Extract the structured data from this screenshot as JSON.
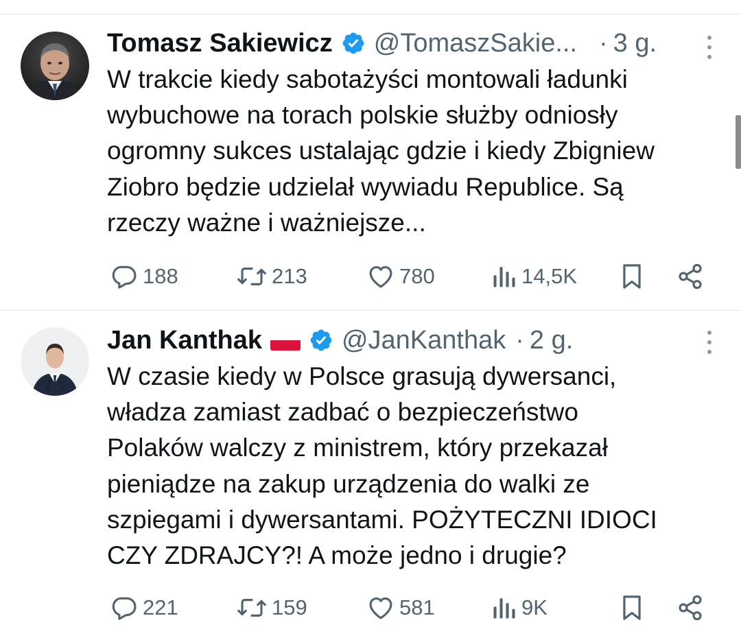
{
  "tweets": [
    {
      "display_name": "Tomasz Sakiewicz",
      "verified": true,
      "handle": "@TomaszSakie...",
      "separator": "·",
      "time": "3 g.",
      "text_lines": [
        "W trakcie kiedy sabotażyści montowali ładunki",
        "wybuchowe na torach polskie służby odniosły",
        "ogromny sukces ustalając gdzie i kiedy Zbigniew",
        "Ziobro będzie udzielał wywiadu Republice. Są",
        "rzeczy ważne i ważniejsze..."
      ],
      "stats": {
        "replies": "188",
        "reposts": "213",
        "likes": "780",
        "views": "14,5K"
      }
    },
    {
      "display_name": "Jan Kanthak",
      "flag": "Poland flag",
      "verified": true,
      "handle": "@JanKanthak",
      "separator": "·",
      "time": "2 g.",
      "text_lines": [
        "W czasie kiedy w Polsce grasują dywersanci,",
        "władza zamiast zadbać o bezpieczeństwo",
        "Polaków walczy z ministrem, który przekazał",
        "pieniądze na zakup urządzenia do walki ze",
        "szpiegami i dywersantami. POŻYTECZNI IDIOCI",
        "CZY ZDRAJCY?! A może jedno i drugie?"
      ],
      "stats": {
        "replies": "221",
        "reposts": "159",
        "likes": "581",
        "views": "9K"
      }
    }
  ],
  "icons": {
    "reply": "speech-bubble-icon",
    "repost": "repost-arrows-icon",
    "like": "heart-icon",
    "views": "bar-chart-icon",
    "bookmark": "bookmark-icon",
    "share": "share-icon",
    "more": "vertical-dots-icon",
    "verified": "verified-badge-icon"
  },
  "colors": {
    "verified_blue": "#1d9bf0",
    "secondary_text": "#536471",
    "primary_text": "#0f1419",
    "divider": "#e3e6e9",
    "flag_red": "#dc143c"
  }
}
